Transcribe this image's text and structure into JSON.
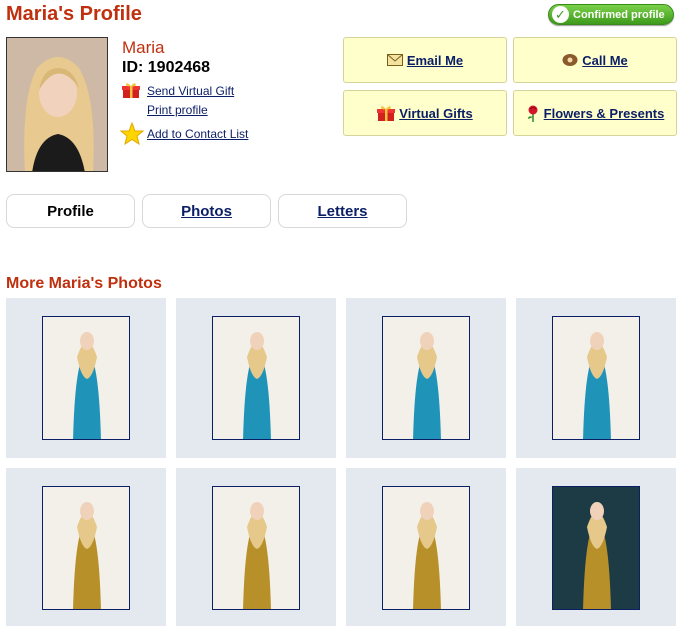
{
  "header": {
    "title": "Maria's Profile",
    "confirmed_label": "Confirmed profile"
  },
  "profile": {
    "name": "Maria",
    "id_text": "ID: 1902468",
    "links": {
      "send_gift": "Send Virtual Gift",
      "print": "Print profile",
      "add_contact": "Add to Contact List"
    }
  },
  "actions": {
    "email": "Email Me",
    "call": "Call Me",
    "virtual_gifts": "Virtual Gifts",
    "flowers": "Flowers & Presents"
  },
  "tabs": [
    {
      "label": "Profile",
      "active": true
    },
    {
      "label": "Photos",
      "active": false
    },
    {
      "label": "Letters",
      "active": false
    }
  ],
  "gallery": {
    "title": "More Maria's Photos",
    "photos": [
      {
        "outfit": "blue lace dress",
        "bg": "light"
      },
      {
        "outfit": "blue satin gown",
        "bg": "light"
      },
      {
        "outfit": "blue lace dress",
        "bg": "light"
      },
      {
        "outfit": "blue satin gown",
        "bg": "light"
      },
      {
        "outfit": "gold sequin dress",
        "bg": "light"
      },
      {
        "outfit": "gold sequin dress",
        "bg": "light"
      },
      {
        "outfit": "gold sequin dress",
        "bg": "light"
      },
      {
        "outfit": "gold sequin dress",
        "bg": "dark"
      }
    ]
  },
  "colors": {
    "accent": "#c0300e",
    "link": "#0b1f66",
    "button_bg": "#ffffcc",
    "tile_bg": "#e4e9f0",
    "confirmed": "#4caf23"
  }
}
